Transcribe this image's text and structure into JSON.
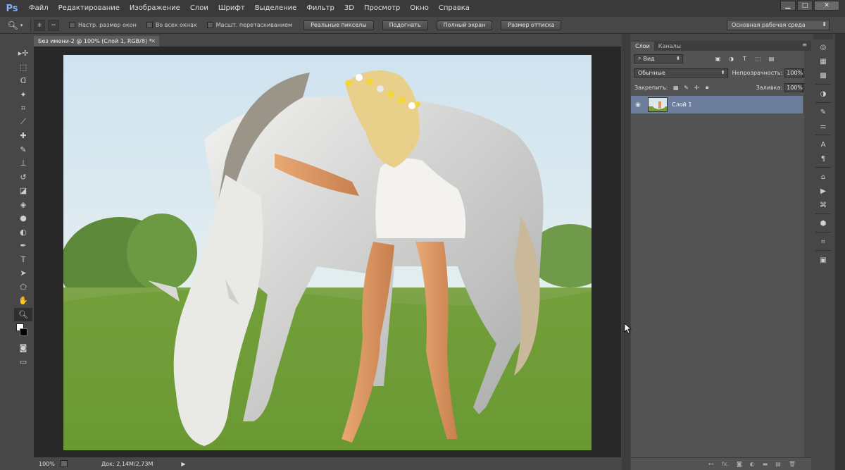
{
  "app": {
    "logo": "Ps",
    "menu": [
      "Файл",
      "Редактирование",
      "Изображение",
      "Слои",
      "Шрифт",
      "Выделение",
      "Фильтр",
      "3D",
      "Просмотр",
      "Окно",
      "Справка"
    ],
    "window_controls": [
      "▁",
      "□",
      "✕"
    ]
  },
  "options": {
    "tool_icon": "zoom-icon",
    "chk_resize": "Настр. размер окон",
    "chk_all_windows": "Во всех окнах",
    "chk_scrubby": "Масшт. перетаскиванием",
    "btn_actual": "Реальные пикселы",
    "btn_fit": "Подогнать",
    "btn_fill": "Полный экран",
    "btn_print": "Размер оттиска",
    "workspace": "Основная рабочая среда"
  },
  "document": {
    "tab_title": "Без имени-2 @ 100% (Слой 1, RGB/8) *",
    "tab_close": "✕"
  },
  "status": {
    "zoom": "100%",
    "doc_size": "Док: 2,14M/2,73M",
    "arrow": "▶"
  },
  "layers_panel": {
    "tabs": [
      "Слои",
      "Каналы"
    ],
    "filter_kind": "Вид",
    "blend_mode": "Обычные",
    "opacity_label": "Непрозрачность:",
    "opacity_value": "100%",
    "lock_label": "Закрепить:",
    "fill_label": "Заливка:",
    "fill_value": "100%",
    "layers": [
      {
        "name": "Слой 1",
        "visible": true,
        "selected": true
      }
    ],
    "footer_icons": [
      "link-icon",
      "fx-icon",
      "mask-icon",
      "adjustment-icon",
      "group-icon",
      "new-layer-icon",
      "trash-icon"
    ],
    "fx_label": "fx."
  },
  "colors": {
    "menubar": "#3a3a3a",
    "panel": "#535353",
    "canvas_bg": "#282828",
    "selected_layer": "#6c7e9c"
  }
}
